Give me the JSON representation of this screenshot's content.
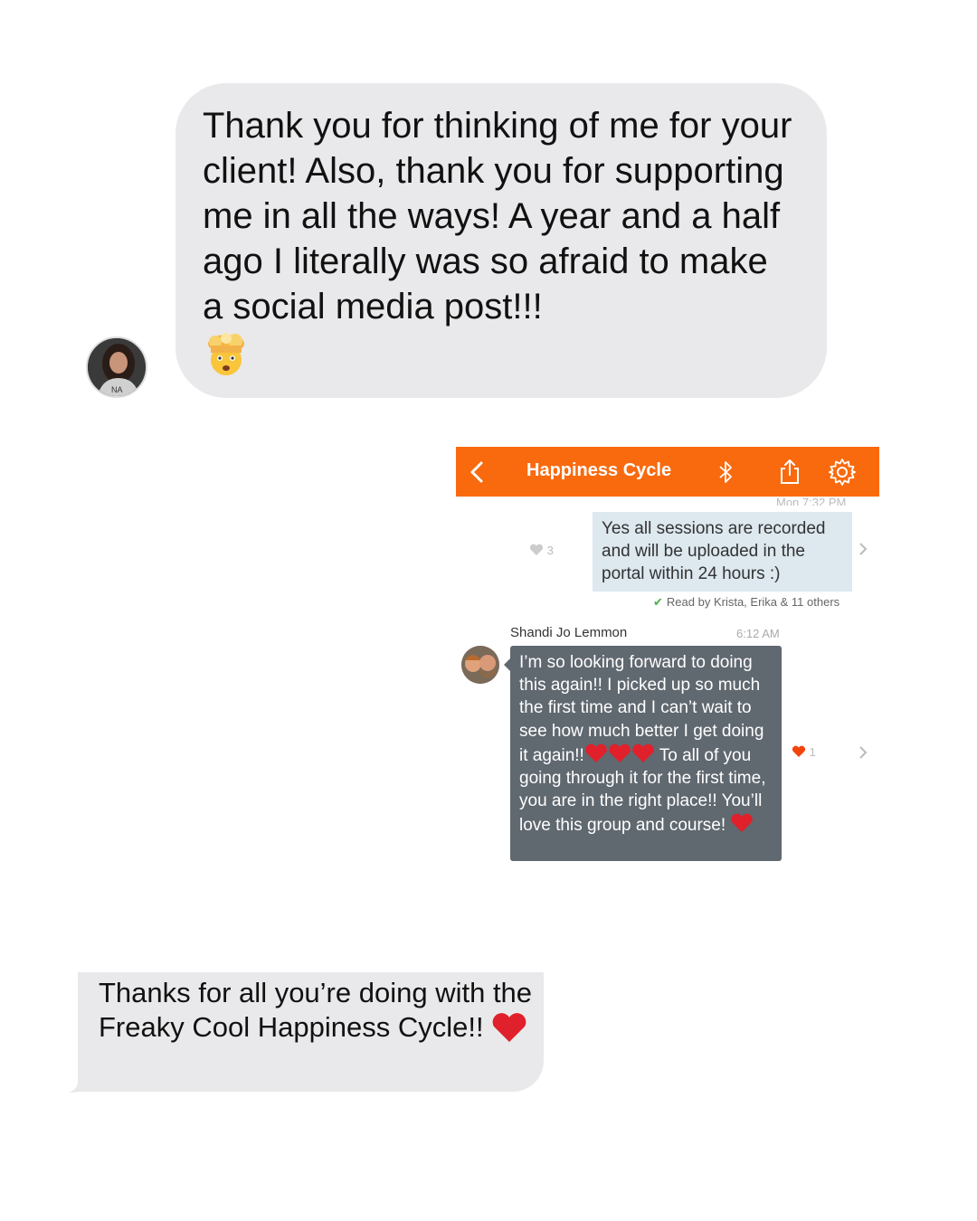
{
  "top_message": {
    "text": "Thank you for thinking of me for your client! Also, thank you for supporting me in all the ways! A year and a half ago I literally was so afraid to make a social media post!!!",
    "emoji": "exploding-head"
  },
  "app": {
    "title": "Happiness Cycle",
    "back_icon": "chevron-left-icon",
    "bluetooth_icon": "bluetooth-icon",
    "share_icon": "share-icon",
    "settings_icon": "gear-icon",
    "accent_color": "#f96a0f",
    "clipped_timestamp": "Mon 7:32 PM"
  },
  "sent_message": {
    "text": "Yes all sessions are recorded and will be uploaded in the portal within 24 hours :)",
    "likes": "3",
    "read_receipt": "Read by Krista, Erika & 11 others"
  },
  "received_message": {
    "sender": "Shandi Jo Lemmon",
    "time": "6:12 AM",
    "text_part1": "I’m so looking forward to doing this again!! I picked up so much the first time and I can’t wait to see how much better I get doing it again!!",
    "text_part2": " To all of you going through it for the first time, you are in the right place!! You’ll love this group and course! ",
    "likes": "1"
  },
  "bottom_message": {
    "text": "Thanks for all you’re doing with the Freaky Cool Happiness Cycle!! "
  }
}
